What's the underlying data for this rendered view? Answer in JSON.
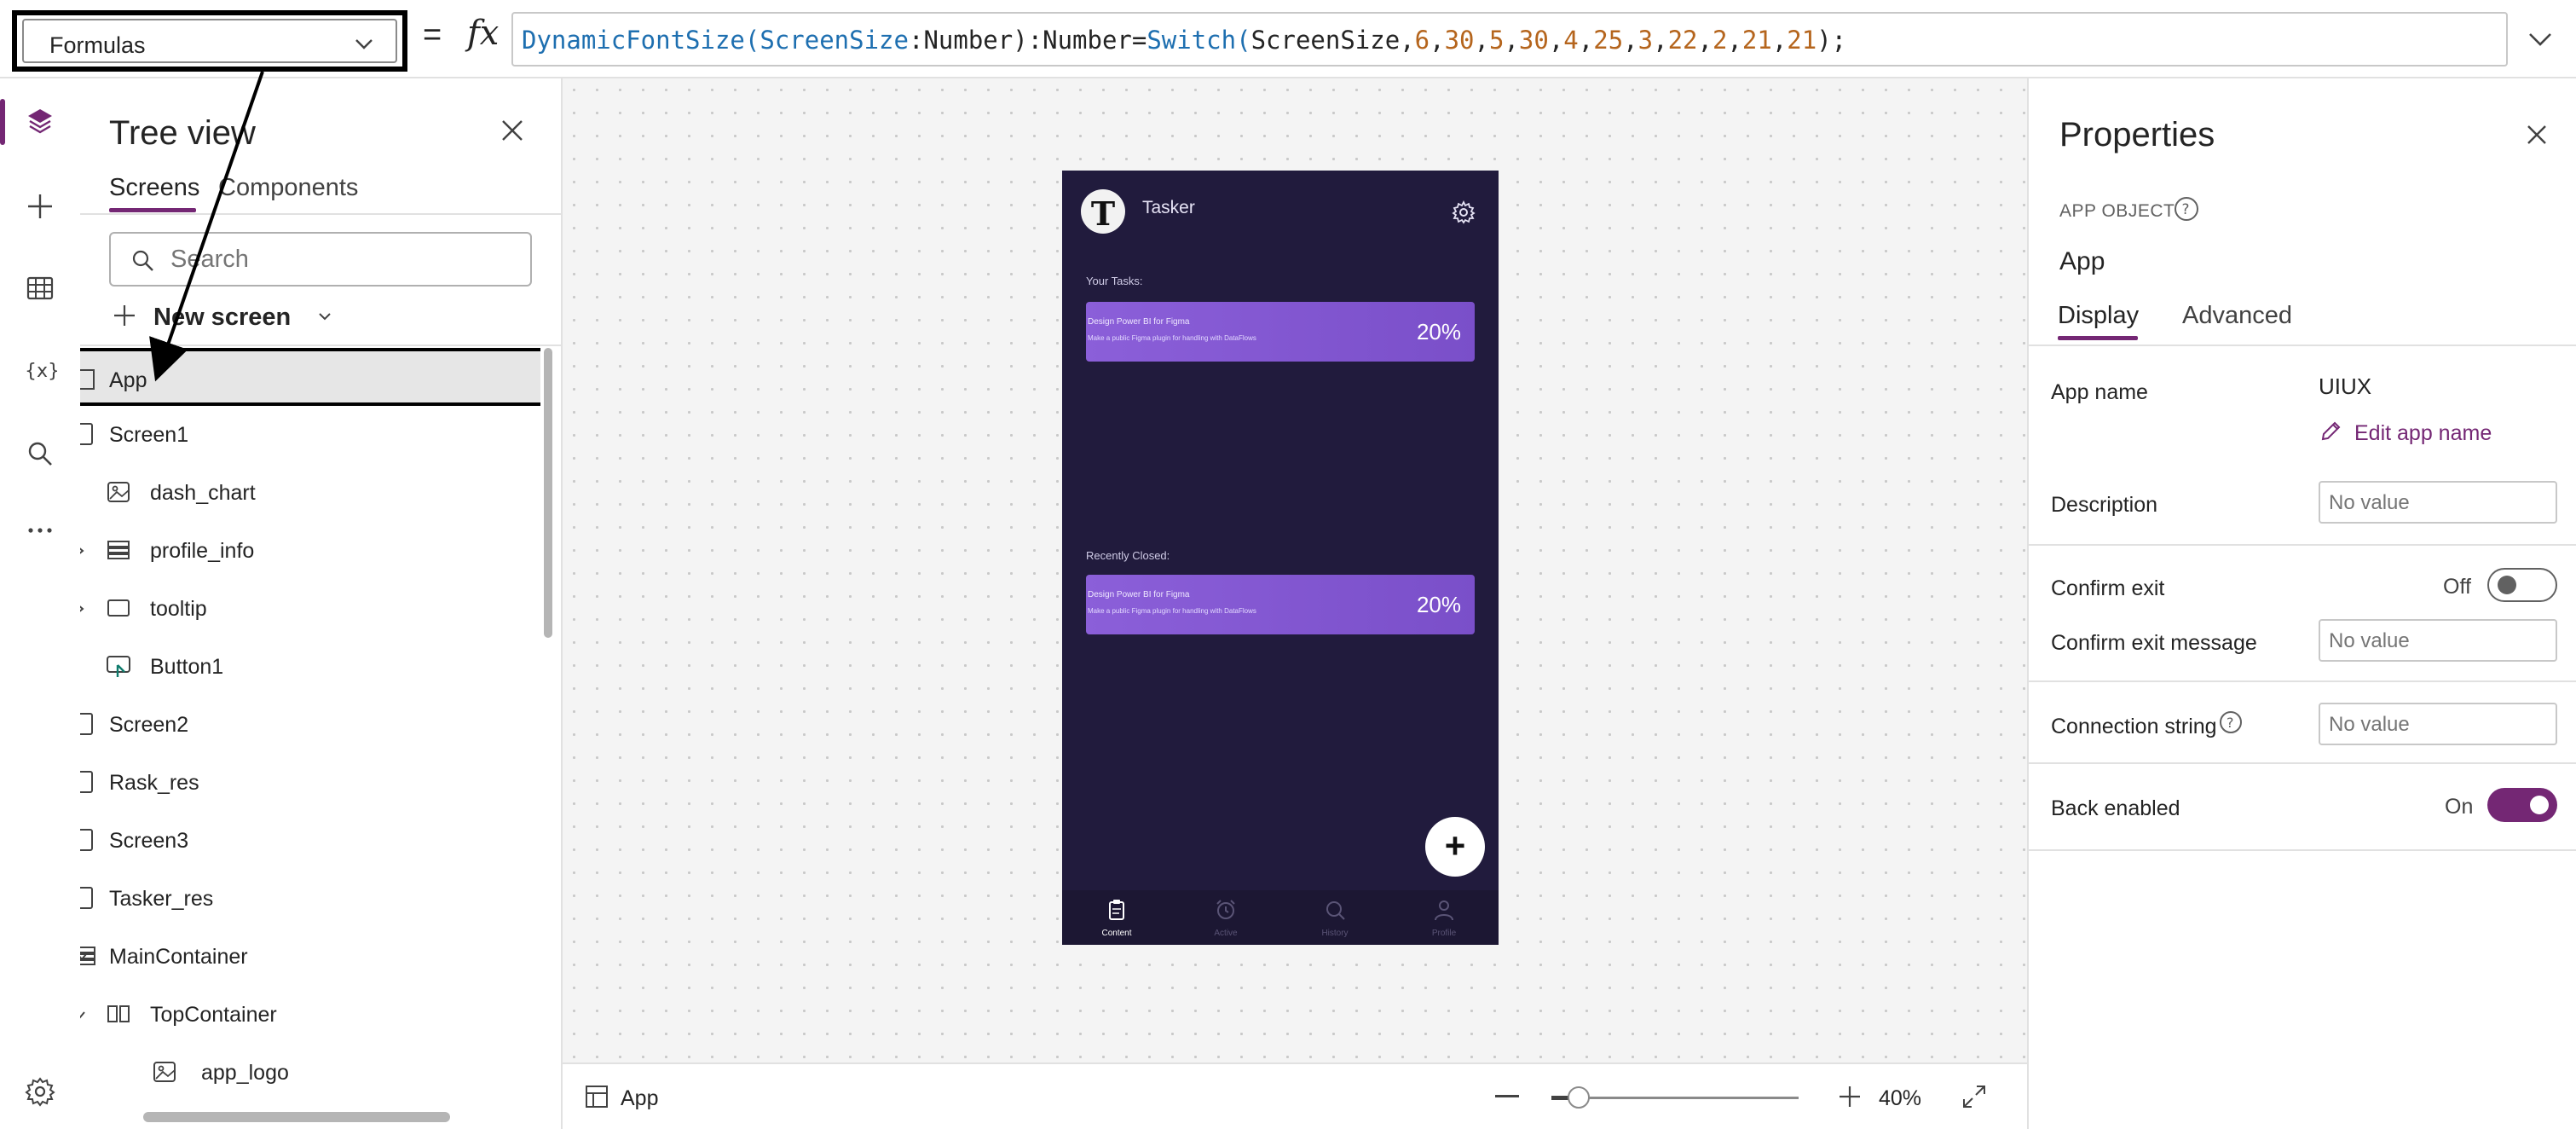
{
  "formula_bar": {
    "property_selected": "Formulas",
    "equals": "=",
    "fx": "fx",
    "formula_tokens": [
      {
        "t": "DynamicFontSize",
        "c": "fn"
      },
      {
        "t": "(",
        "c": "fn"
      },
      {
        "t": "ScreenSize",
        "c": "id"
      },
      {
        "t": ":Number",
        "c": "plain"
      },
      {
        "t": "):Number=",
        "c": "plain"
      },
      {
        "t": "Switch",
        "c": "fn"
      },
      {
        "t": "(",
        "c": "fn"
      },
      {
        "t": "ScreenSize,",
        "c": "plain"
      },
      {
        "t": "6",
        "c": "num"
      },
      {
        "t": ",",
        "c": "plain"
      },
      {
        "t": "30",
        "c": "num"
      },
      {
        "t": ",",
        "c": "plain"
      },
      {
        "t": "5",
        "c": "num"
      },
      {
        "t": ",",
        "c": "plain"
      },
      {
        "t": "30",
        "c": "num"
      },
      {
        "t": ",",
        "c": "plain"
      },
      {
        "t": "4",
        "c": "num"
      },
      {
        "t": ",",
        "c": "plain"
      },
      {
        "t": "25",
        "c": "num"
      },
      {
        "t": ",",
        "c": "plain"
      },
      {
        "t": "3",
        "c": "num"
      },
      {
        "t": ",",
        "c": "plain"
      },
      {
        "t": "22",
        "c": "num"
      },
      {
        "t": ",",
        "c": "plain"
      },
      {
        "t": "2",
        "c": "num"
      },
      {
        "t": ",",
        "c": "plain"
      },
      {
        "t": "21",
        "c": "num"
      },
      {
        "t": ",",
        "c": "plain"
      },
      {
        "t": "21",
        "c": "num"
      },
      {
        "t": ");",
        "c": "plain"
      }
    ]
  },
  "tree_view": {
    "title": "Tree view",
    "tabs": [
      "Screens",
      "Components"
    ],
    "search_placeholder": "Search",
    "new_screen": "New screen",
    "items": [
      {
        "label": "App",
        "icon": "app-icon",
        "selected": true
      },
      {
        "label": "Screen1",
        "icon": "screen-icon"
      },
      {
        "label": "dash_chart",
        "icon": "image-icon"
      },
      {
        "label": "profile_info",
        "icon": "container-icon",
        "expandable": true
      },
      {
        "label": "tooltip",
        "icon": "rectangle-icon",
        "expandable": true
      },
      {
        "label": "Button1",
        "icon": "button-icon"
      },
      {
        "label": "Screen2",
        "icon": "screen-icon"
      },
      {
        "label": "Rask_res",
        "icon": "screen-icon"
      },
      {
        "label": "Screen3",
        "icon": "screen-icon"
      },
      {
        "label": "Tasker_res",
        "icon": "screen-icon"
      },
      {
        "label": "MainContainer",
        "icon": "container-icon",
        "expanded": true
      },
      {
        "label": "TopContainer",
        "icon": "horizontal-container-icon",
        "expanded": true
      },
      {
        "label": "app_logo",
        "icon": "image-icon"
      }
    ]
  },
  "preview": {
    "app_title": "Tasker",
    "logo_letter": "T",
    "section_tasks": "Your Tasks:",
    "section_closed": "Recently Closed:",
    "cards": [
      {
        "title": "Design Power BI for Figma",
        "subtitle": "Make a public Figma plugin for handling with DataFlows",
        "percent": "20%"
      },
      {
        "title": "Design Power BI for Figma",
        "subtitle": "Make a public Figma plugin for handling with DataFlows",
        "percent": "20%"
      }
    ],
    "fab": "+",
    "nav": [
      {
        "label": "Content",
        "icon": "clipboard-icon",
        "active": true
      },
      {
        "label": "Active",
        "icon": "alarm-icon"
      },
      {
        "label": "History",
        "icon": "search-icon"
      },
      {
        "label": "Profile",
        "icon": "person-icon"
      }
    ]
  },
  "canvas_bar": {
    "screen_label": "App",
    "zoom": "40%",
    "zoom_value": 0.4
  },
  "properties": {
    "title": "Properties",
    "object_type": "APP OBJECT",
    "object_name": "App",
    "tabs": [
      "Display",
      "Advanced"
    ],
    "app_name_label": "App name",
    "app_name_value": "UIUX",
    "edit_app_name": "Edit app name",
    "description_label": "Description",
    "confirm_exit_label": "Confirm exit",
    "confirm_exit_state": "Off",
    "confirm_exit_message_label": "Confirm exit message",
    "connection_string_label": "Connection string",
    "back_enabled_label": "Back enabled",
    "back_enabled_state": "On",
    "placeholder": "No value"
  },
  "colors": {
    "accent": "#742774",
    "device_bg": "#211b3d",
    "card": "#8b5fd9"
  }
}
